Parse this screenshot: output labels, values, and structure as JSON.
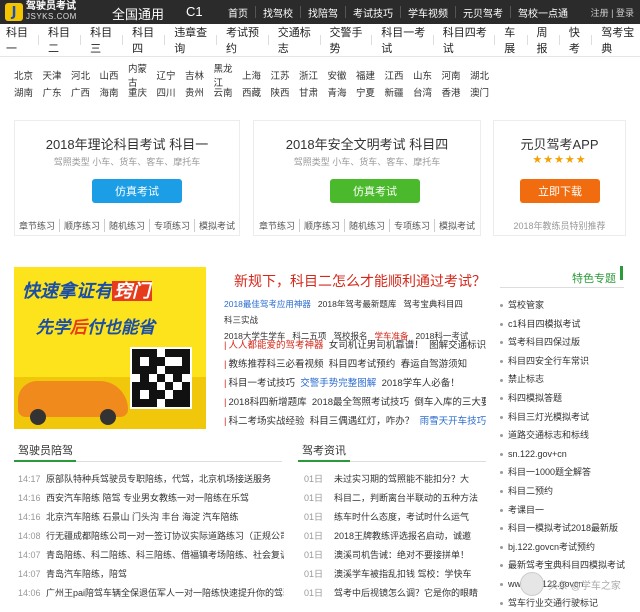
{
  "logo": {
    "cn": "驾驶员考试",
    "en": "JSYKS.COM",
    "mark": "J"
  },
  "top": {
    "region": "全国通用",
    "subject": "C1",
    "nav": [
      "首页",
      "找驾校",
      "找陪驾",
      "考试技巧",
      "学车视频",
      "元贝驾考",
      "驾校一点通"
    ],
    "auth": "注册 | 登录"
  },
  "subnav": [
    "科目一",
    "科目二",
    "科目三",
    "科目四",
    "违章查询",
    "考试预约",
    "交通标志",
    "交警手势",
    "科目一考试",
    "科目四考试",
    "车展",
    "周报",
    "快考",
    "驾考宝典"
  ],
  "provinces": {
    "row1": [
      "北京",
      "天津",
      "河北",
      "山西",
      "内蒙古",
      "辽宁",
      "吉林",
      "黑龙江",
      "上海",
      "江苏",
      "浙江",
      "安徽",
      "福建",
      "江西",
      "山东",
      "河南",
      "湖北"
    ],
    "row2": [
      "湖南",
      "广东",
      "广西",
      "海南",
      "重庆",
      "四川",
      "贵州",
      "云南",
      "西藏",
      "陕西",
      "甘肃",
      "青海",
      "宁夏",
      "新疆",
      "台湾",
      "香港",
      "澳门"
    ]
  },
  "cards": {
    "c1": {
      "title": "2018年理论科目考试 科目一",
      "sub": "驾照类型 小车、货车、客车、摩托车",
      "button": "仿真考试",
      "links": [
        "章节练习",
        "顺序练习",
        "随机练习",
        "专项练习",
        "模拟考试"
      ]
    },
    "c2": {
      "title": "2018年安全文明考试 科目四",
      "sub": "驾照类型 小车、货车、客车、摩托车",
      "button": "仿真考试",
      "links": [
        "章节练习",
        "顺序练习",
        "随机练习",
        "专项练习",
        "模拟考试"
      ]
    },
    "c3": {
      "title": "元贝驾考APP",
      "stars": "★★★★★",
      "button": "立即下载",
      "sub": "2018年教练员特别推荐"
    }
  },
  "banner": {
    "l1a": "快速拿证有",
    "l1b": "窍门",
    "l2a": "先学",
    "l2b": "后",
    "l2c": "付也能省"
  },
  "news": {
    "title": "新规下，科目二怎么才能顺利通过考试？",
    "tags": [
      {
        "t": "2018最佳驾考应用神器",
        "c": "blue"
      },
      {
        "t": "2018年驾考最新题库",
        "c": ""
      },
      {
        "t": "驾考宝典科目四",
        "c": ""
      },
      {
        "t": "科三实战",
        "c": ""
      },
      {
        "t": "2018大学生学车",
        "c": ""
      },
      {
        "t": "科二五项",
        "c": ""
      },
      {
        "t": "驾校报名",
        "c": ""
      },
      {
        "t": "学车准备",
        "c": "red"
      },
      {
        "t": "2018科一考试",
        "c": ""
      }
    ],
    "lines": [
      {
        "a": "人人都能爱的驾考神器",
        "ac": "red",
        "b": "女司机让男司机靠谱！",
        "c": "图解交通标识大全"
      },
      {
        "a": "教练推荐科三必看视频",
        "ac": "",
        "b": "科目四考试预约",
        "c": "春运自驾游须知"
      },
      {
        "a": "科目一考试技巧",
        "ac": "",
        "b": "交警手势完整图解",
        "bc": "blue",
        "c": "2018学车人必备！"
      },
      {
        "a": "2018科四新增题库",
        "ac": "",
        "b": "2018最全驾照考试技巧",
        "c": "倒车入库的三大要点"
      },
      {
        "a": "科二考场实战经验",
        "ac": "",
        "b": "科目三偶遇红灯，咋办？",
        "c": "雨雪天开车技巧",
        "cc": "blue"
      }
    ]
  },
  "side": {
    "title": "特色专题",
    "items": [
      "驾校管家",
      "c1科目四模拟考试",
      "驾考科目四保过版",
      "科目四安全行车常识",
      "禁止标志",
      "科四模拟答题",
      "科目三灯光模拟考试",
      "道路交通标志和标线",
      "sn.122.gov+cn",
      "科目一1000题全解答",
      "科目二预约",
      "考课目一",
      "科目一模拟考试2018最新版",
      "bj.122.govcn考试预约",
      "最新驾考宝典科目四模拟考试",
      "www.ah.122.govcn",
      "驾车行业交通行驶标记"
    ]
  },
  "sections": {
    "left": {
      "title": "驾驶员陪驾",
      "items": [
        {
          "t": "14:17",
          "s": "原部队特种兵驾驶员专职陪练，代驾，北京机场接送服务"
        },
        {
          "t": "14:16",
          "s": "西安汽车陪练 陪驾 专业男女教练一对一陪练在乐驾"
        },
        {
          "t": "14:16",
          "s": "北京汽车陪练 石景山 门头沟 丰台 海淀 汽车陪练"
        },
        {
          "t": "14:08",
          "s": "行无疆成都陪练公司一对一签订协议实际道路练习（正规公司）"
        },
        {
          "t": "14:07",
          "s": "青岛陪练、科二陪练、科三陪练、借福镇考场陪练、社会复训"
        },
        {
          "t": "14:07",
          "s": "青岛汽车陪练，陪驾"
        },
        {
          "t": "14:06",
          "s": "广州王pai陪驾车辆全保退伍军人一对一陪练快速提升你的驾驶"
        }
      ]
    },
    "right": {
      "title": "驾考资讯",
      "items": [
        {
          "d": "01日",
          "s": "未过实习期的驾照能不能扣分？大"
        },
        {
          "d": "01日",
          "s": "科目二，判断离台半联动的五种方法"
        },
        {
          "d": "01日",
          "s": "练车时什么态度，考试时什么运气"
        },
        {
          "d": "01日",
          "s": "2018王牌教练评选报名启动，诚邀"
        },
        {
          "d": "01日",
          "s": "澳溪司机告诫：绝对不要接拼单！"
        },
        {
          "d": "01日",
          "s": "澳溪学车被指乱扣钱 驾校：学快车"
        },
        {
          "d": "01日",
          "s": "驾考中后视镜怎么调？它是你的眼睛"
        }
      ]
    }
  },
  "watermark": "头条 @学车之家"
}
